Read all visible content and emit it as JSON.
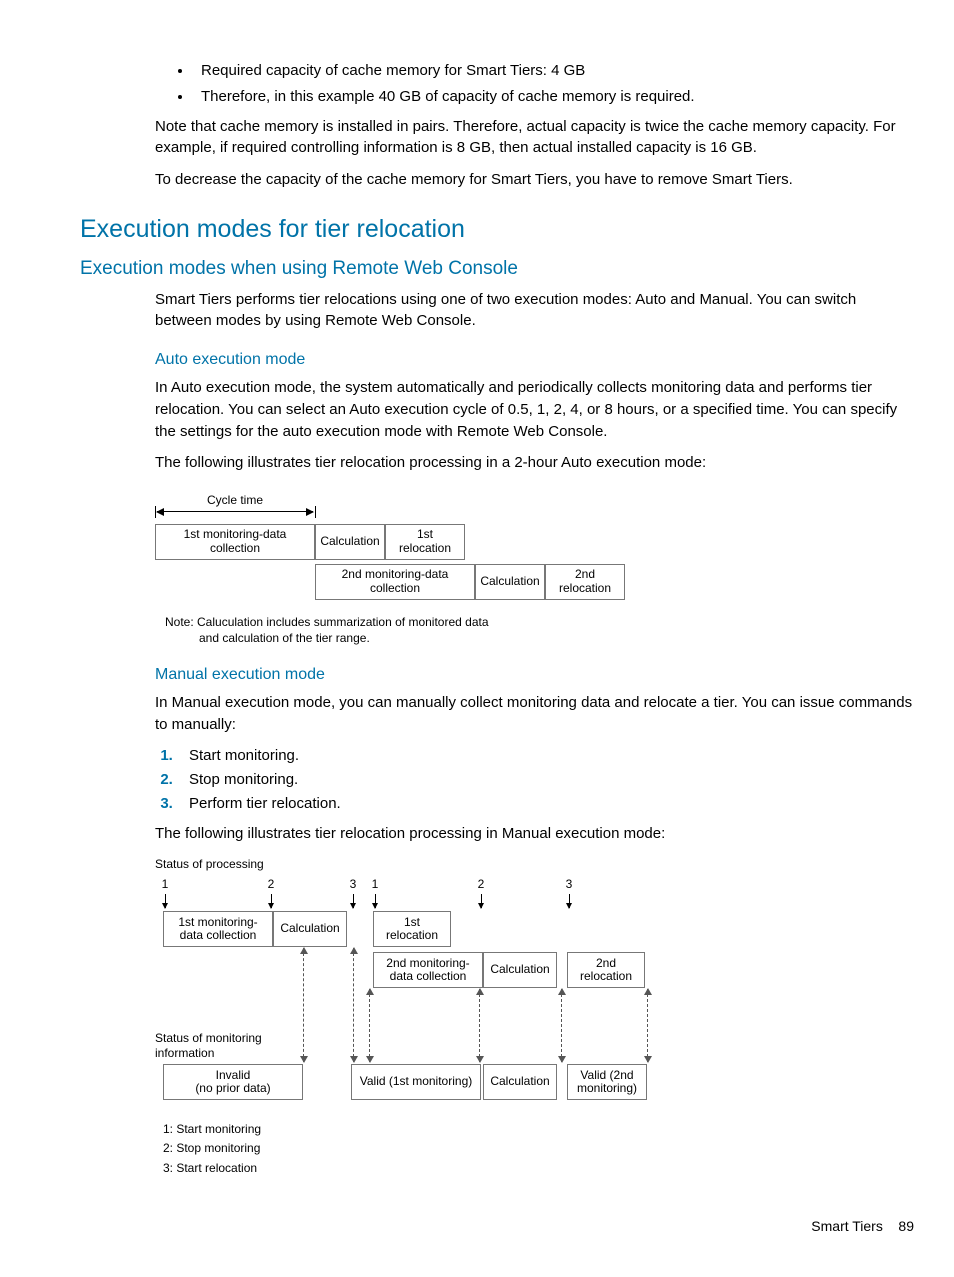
{
  "bullets": [
    "Required capacity of cache memory for Smart Tiers: 4 GB",
    "Therefore, in this example 40 GB of capacity of cache memory is required."
  ],
  "para_note": "Note that cache memory is installed in pairs. Therefore, actual capacity is twice the cache memory capacity. For example, if required controlling information is 8 GB, then actual installed capacity is 16 GB.",
  "para_decrease": "To decrease the capacity of the cache memory for Smart Tiers, you have to remove Smart Tiers.",
  "h1": "Execution modes for tier relocation",
  "h2": "Execution modes when using Remote Web Console",
  "para_intro": "Smart Tiers performs tier relocations using one of two execution modes: Auto and Manual. You can switch between modes by using Remote Web Console.",
  "auto": {
    "title": "Auto execution mode",
    "p1": "In Auto execution mode, the system automatically and periodically collects monitoring data and performs tier relocation. You can select an Auto execution cycle of 0.5, 1, 2, 4, or 8 hours, or a specified time. You can specify the settings for the auto execution mode with Remote Web Console.",
    "p2": "The following illustrates tier relocation processing in a 2-hour Auto execution mode:"
  },
  "diag1": {
    "cycle_label": "Cycle time",
    "r1": {
      "a": "1st monitoring-data collection",
      "b": "Calculation",
      "c": "1st relocation"
    },
    "r2": {
      "a": "2nd monitoring-data collection",
      "b": "Calculation",
      "c": "2nd relocation"
    },
    "note_l1": "Note: Caluculation includes summarization of monitored data",
    "note_l2": "and calculation of the tier range."
  },
  "manual": {
    "title": "Manual execution mode",
    "p1": "In Manual execution mode, you can manually collect monitoring data and relocate a tier. You can issue commands to manually:",
    "steps": [
      "Start monitoring.",
      "Stop monitoring.",
      "Perform tier relocation."
    ],
    "p2": "The following illustrates tier relocation processing in Manual execution mode:"
  },
  "diag2": {
    "status_proc": "Status of processing",
    "status_mon": "Status of monitoring information",
    "nums": {
      "n1": "1",
      "n2": "2",
      "n3": "3"
    },
    "boxes": {
      "a": "1st monitoring-data collection",
      "b": "Calculation",
      "c": "1st relocation",
      "d": "2nd monitoring-data collection",
      "e": "Calculation",
      "f": "2nd relocation",
      "g": "Invalid\n(no prior data)",
      "h": "Valid (1st monitoring)",
      "i": "Calculation",
      "j": "Valid (2nd monitoring)"
    },
    "legend": {
      "l1": "1: Start monitoring",
      "l2": "2: Stop monitoring",
      "l3": "3: Start relocation"
    }
  },
  "footer": {
    "label": "Smart Tiers",
    "page": "89"
  }
}
